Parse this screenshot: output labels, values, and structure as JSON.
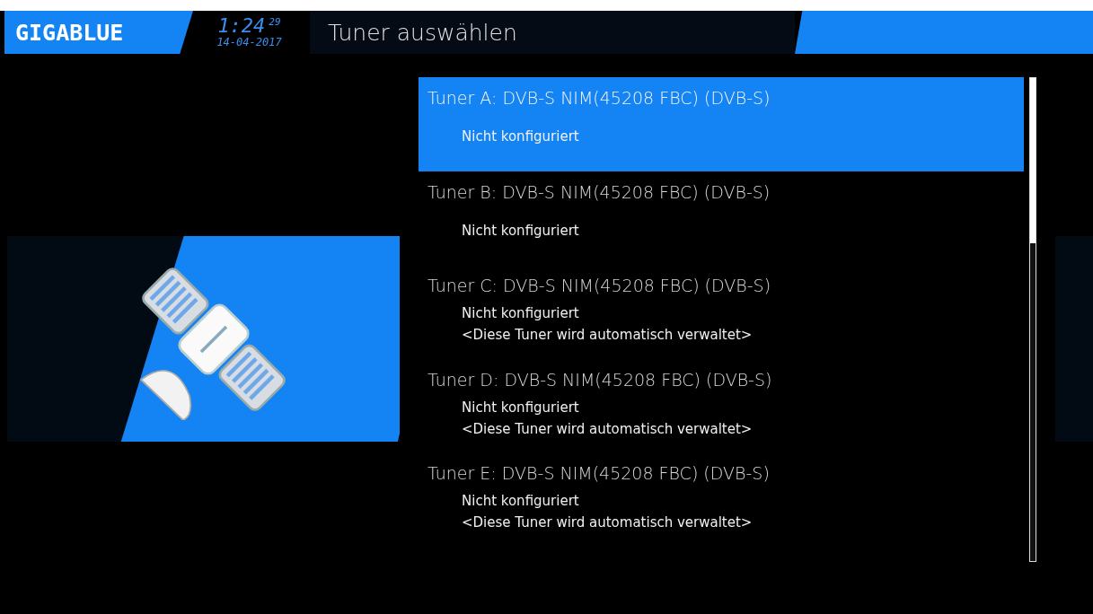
{
  "header": {
    "logo": "GIGABLUE",
    "time": "1:24",
    "seconds": "29",
    "date": "14-04-2017",
    "title": "Tuner auswählen"
  },
  "tuners": [
    {
      "title": "Tuner A: DVB-S NIM(45208 FBC) (DVB-S)",
      "lines": [
        "Nicht konfiguriert"
      ],
      "selected": true
    },
    {
      "title": "Tuner B: DVB-S NIM(45208 FBC) (DVB-S)",
      "lines": [
        "Nicht konfiguriert"
      ],
      "selected": false
    },
    {
      "title": "Tuner C: DVB-S NIM(45208 FBC) (DVB-S)",
      "lines": [
        "Nicht konfiguriert",
        "<Diese Tuner wird automatisch verwaltet>"
      ],
      "selected": false
    },
    {
      "title": "Tuner D: DVB-S NIM(45208 FBC) (DVB-S)",
      "lines": [
        "Nicht konfiguriert",
        "<Diese Tuner wird automatisch verwaltet>"
      ],
      "selected": false
    },
    {
      "title": "Tuner E: DVB-S NIM(45208 FBC) (DVB-S)",
      "lines": [
        "Nicht konfiguriert",
        "<Diese Tuner wird automatisch verwaltet>"
      ],
      "selected": false
    }
  ]
}
